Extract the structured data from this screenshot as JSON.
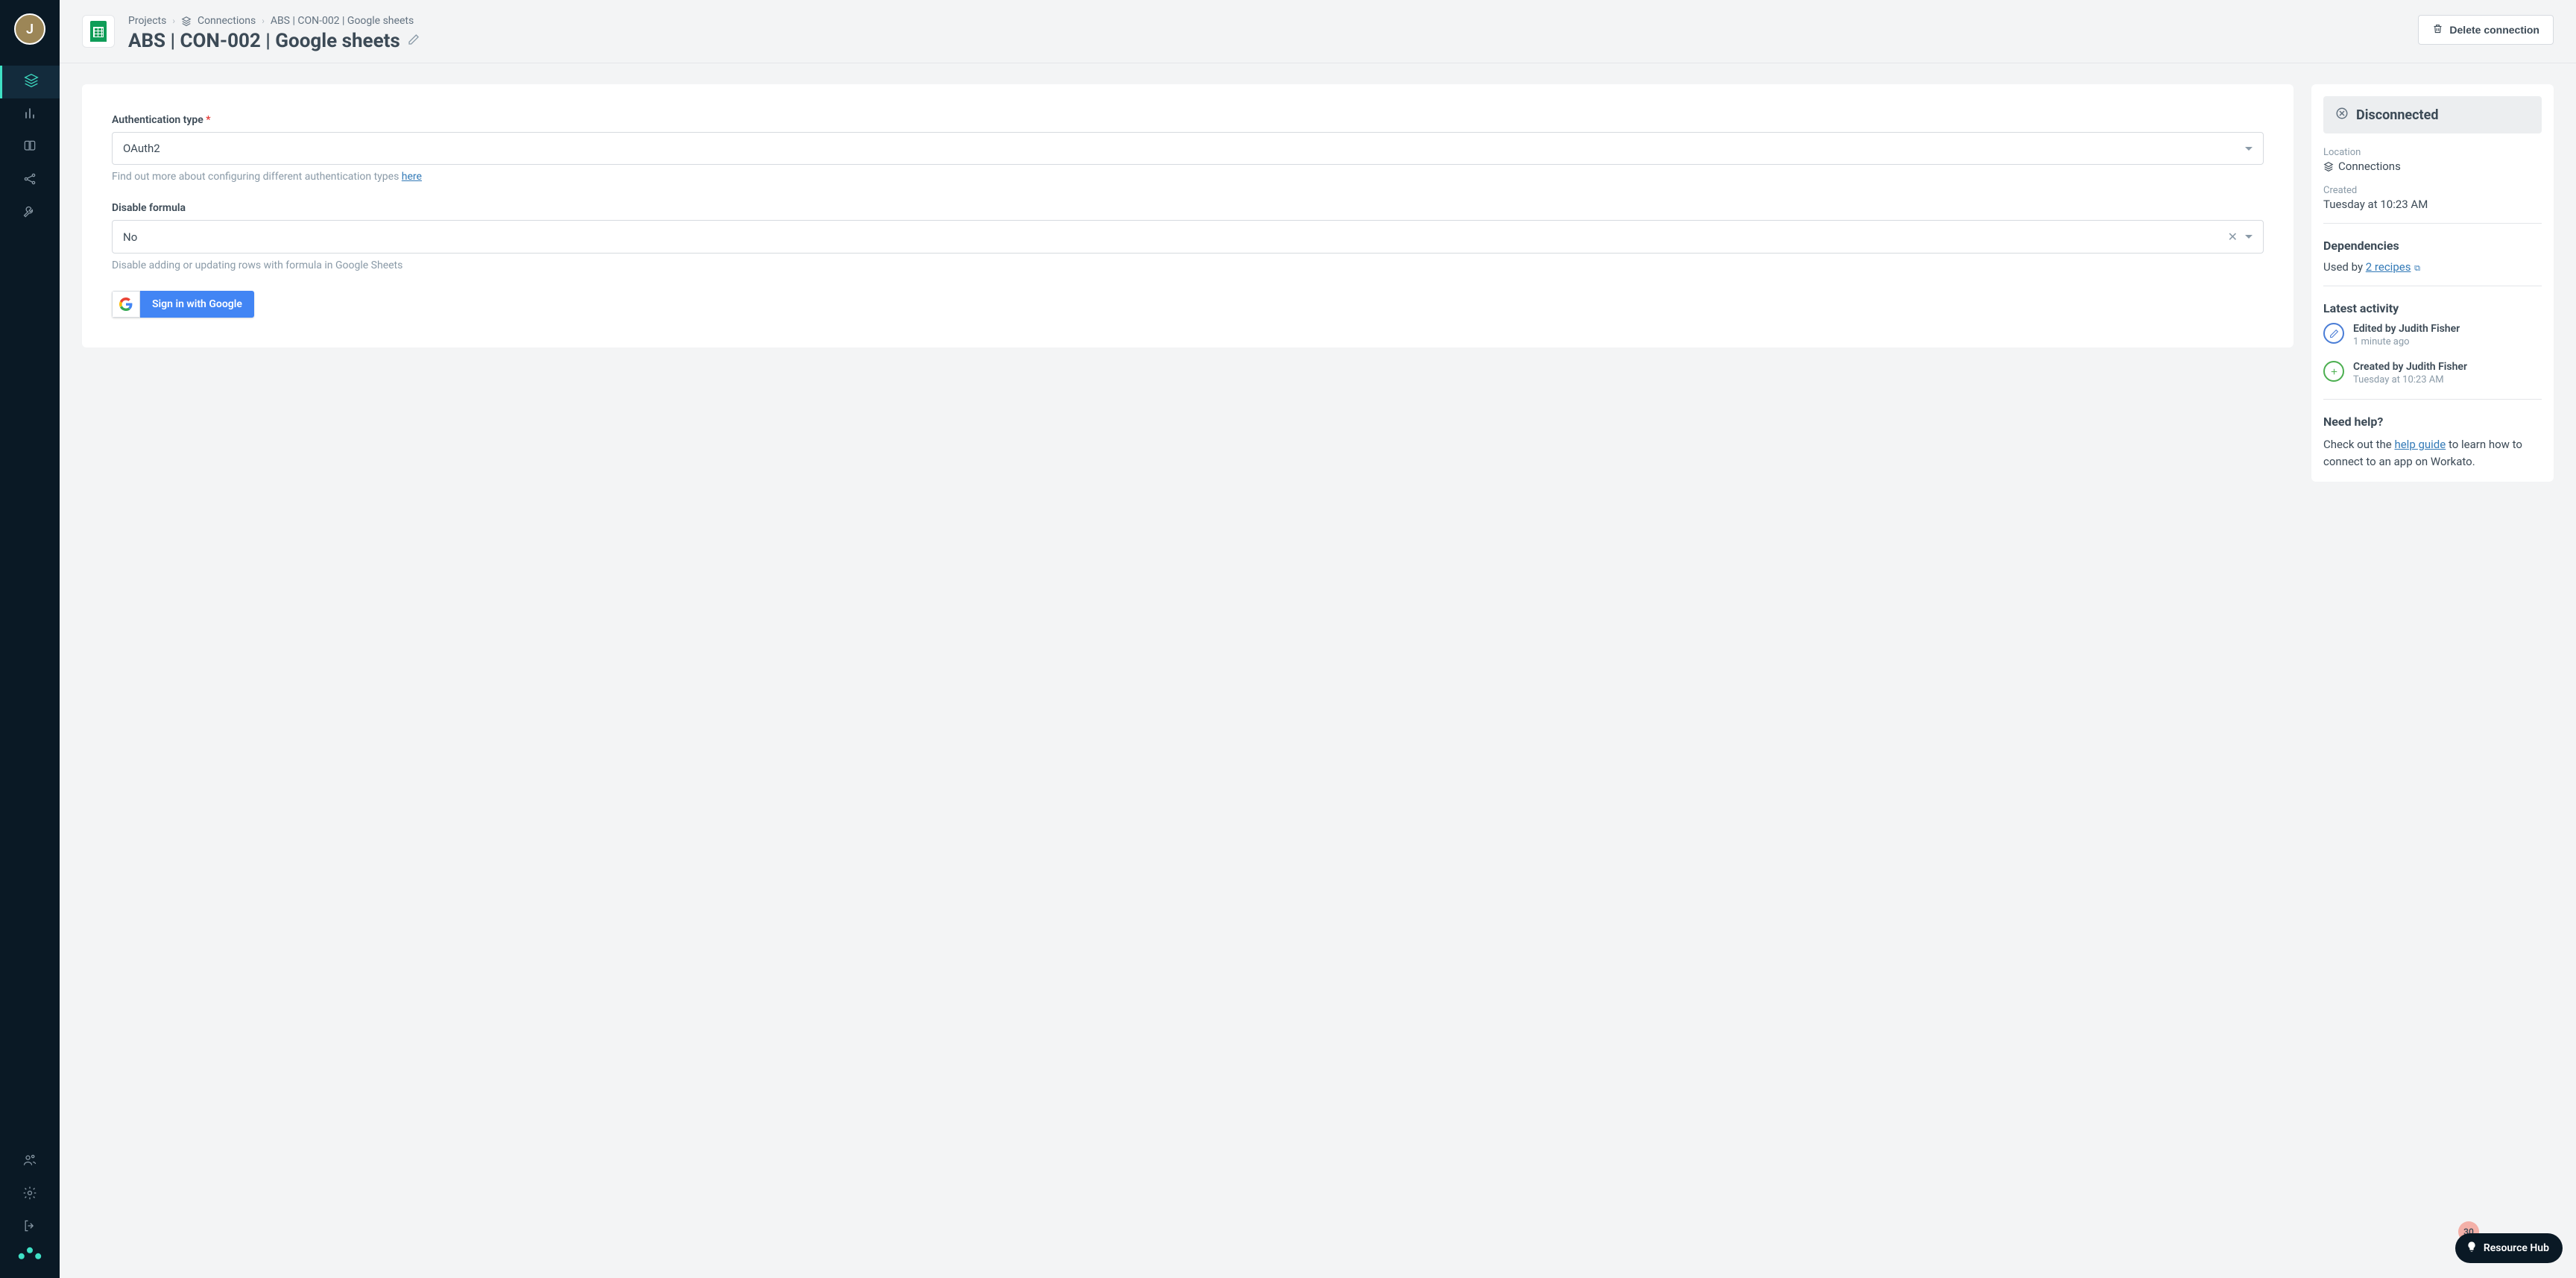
{
  "user": {
    "initial": "J"
  },
  "breadcrumb": {
    "projects": "Projects",
    "connections": "Connections",
    "current": "ABS | CON-002 | Google sheets"
  },
  "page": {
    "title": "ABS | CON-002 | Google sheets",
    "delete_label": "Delete connection"
  },
  "form": {
    "auth_type": {
      "label": "Authentication type",
      "value": "OAuth2",
      "help_prefix": "Find out more about configuring different authentication types ",
      "help_link": "here"
    },
    "disable_formula": {
      "label": "Disable formula",
      "value": "No",
      "help": "Disable adding or updating rows with formula in Google Sheets"
    },
    "signin_label": "Sign in with Google"
  },
  "side": {
    "status": "Disconnected",
    "location_label": "Location",
    "location_value": "Connections",
    "created_label": "Created",
    "created_value": "Tuesday at 10:23 AM",
    "dependencies_title": "Dependencies",
    "used_by_prefix": "Used by ",
    "used_by_link": "2 recipes",
    "activity_title": "Latest activity",
    "activity": [
      {
        "title": "Edited by Judith Fisher",
        "time": "1 minute ago",
        "type": "edit"
      },
      {
        "title": "Created by Judith Fisher",
        "time": "Tuesday at 10:23 AM",
        "type": "create"
      }
    ],
    "help_title": "Need help?",
    "help_prefix": "Check out the ",
    "help_link": "help guide",
    "help_suffix": " to learn how to connect to an app on Workato."
  },
  "resource_hub": {
    "label": "Resource Hub",
    "badge": "30"
  }
}
